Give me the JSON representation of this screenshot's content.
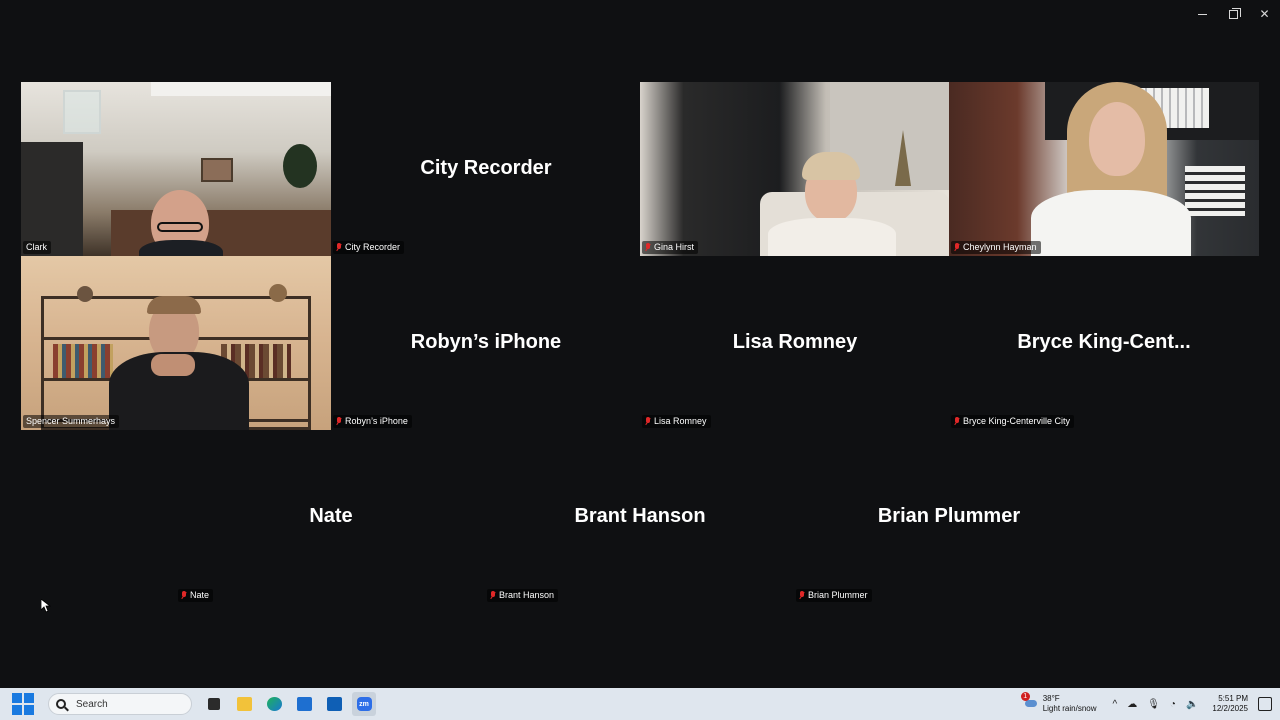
{
  "window": {
    "minimize": "—",
    "restore": "",
    "close": "✕"
  },
  "tiles": [
    {
      "id": "clark",
      "label": "Clark",
      "video": true,
      "active": true
    },
    {
      "id": "city-recorder",
      "label": "City Recorder",
      "big": "City Recorder",
      "video": false
    },
    {
      "id": "gina",
      "label": "Gina Hirst",
      "video": true
    },
    {
      "id": "cheylynn",
      "label": "Cheylynn Hayman",
      "video": true
    },
    {
      "id": "spencer",
      "label": "Spencer Summerhays",
      "video": true
    },
    {
      "id": "robyn",
      "label": "Robyn’s iPhone",
      "big": "Robyn’s iPhone",
      "video": false
    },
    {
      "id": "lisa",
      "label": "Lisa Romney",
      "big": "Lisa Romney",
      "video": false
    },
    {
      "id": "bryce",
      "label": "Bryce King-Centerville City",
      "big": "Bryce  King-Cent...",
      "video": false
    },
    {
      "id": "nate",
      "label": "Nate",
      "big": "Nate",
      "video": false
    },
    {
      "id": "brant",
      "label": "Brant Hanson",
      "big": "Brant Hanson",
      "video": false
    },
    {
      "id": "brian",
      "label": "Brian Plummer",
      "big": "Brian Plummer",
      "video": false
    }
  ],
  "taskbar": {
    "search_placeholder": "Search",
    "weather_temp": "38°F",
    "weather_desc": "Light rain/snow",
    "weather_badge": "1",
    "time": "5:51 PM",
    "date": "12/2/2025"
  }
}
